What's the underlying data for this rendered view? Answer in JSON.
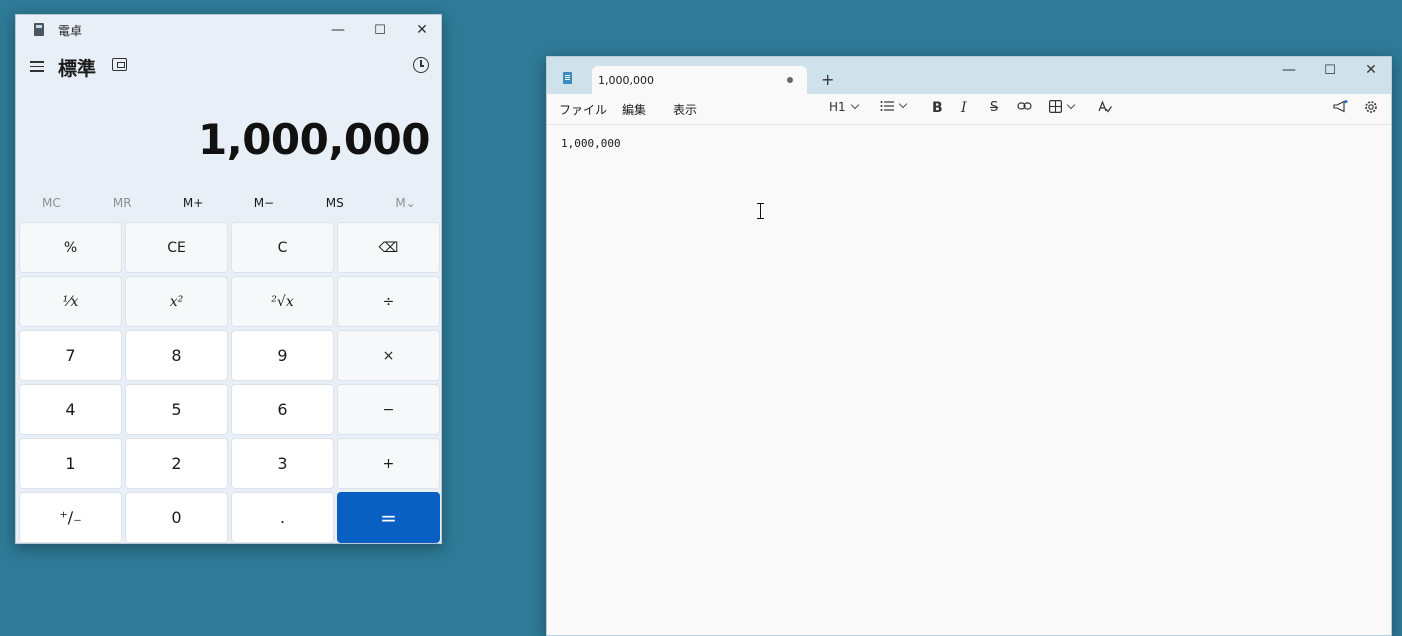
{
  "calculator": {
    "title": "電卓",
    "mode": "標準",
    "display": "1,000,000",
    "window_controls": {
      "minimize": "—",
      "maximize": "☐",
      "close": "✕"
    },
    "memory": [
      "MC",
      "MR",
      "M+",
      "M−",
      "MS",
      "M⌄"
    ],
    "keys": {
      "percent": "%",
      "ce": "CE",
      "c": "C",
      "backspace": "⌫",
      "reciprocal": "¹⁄x",
      "square": "x²",
      "sqrt": "²√x",
      "divide": "÷",
      "seven": "7",
      "eight": "8",
      "nine": "9",
      "multiply": "×",
      "four": "4",
      "five": "5",
      "six": "6",
      "minus": "−",
      "one": "1",
      "two": "2",
      "three": "3",
      "plus": "+",
      "negate": "⁺∕₋",
      "zero": "0",
      "decimal": ".",
      "equals": "="
    }
  },
  "notepad": {
    "tab_title": "1,000,000",
    "new_tab": "+",
    "window_controls": {
      "minimize": "—",
      "maximize": "☐",
      "close": "✕"
    },
    "menu": {
      "file": "ファイル",
      "edit": "編集",
      "view": "表示"
    },
    "toolbar": {
      "heading": "H1",
      "bold": "B",
      "italic": "I",
      "strike": "S"
    },
    "content": "1,000,000"
  }
}
